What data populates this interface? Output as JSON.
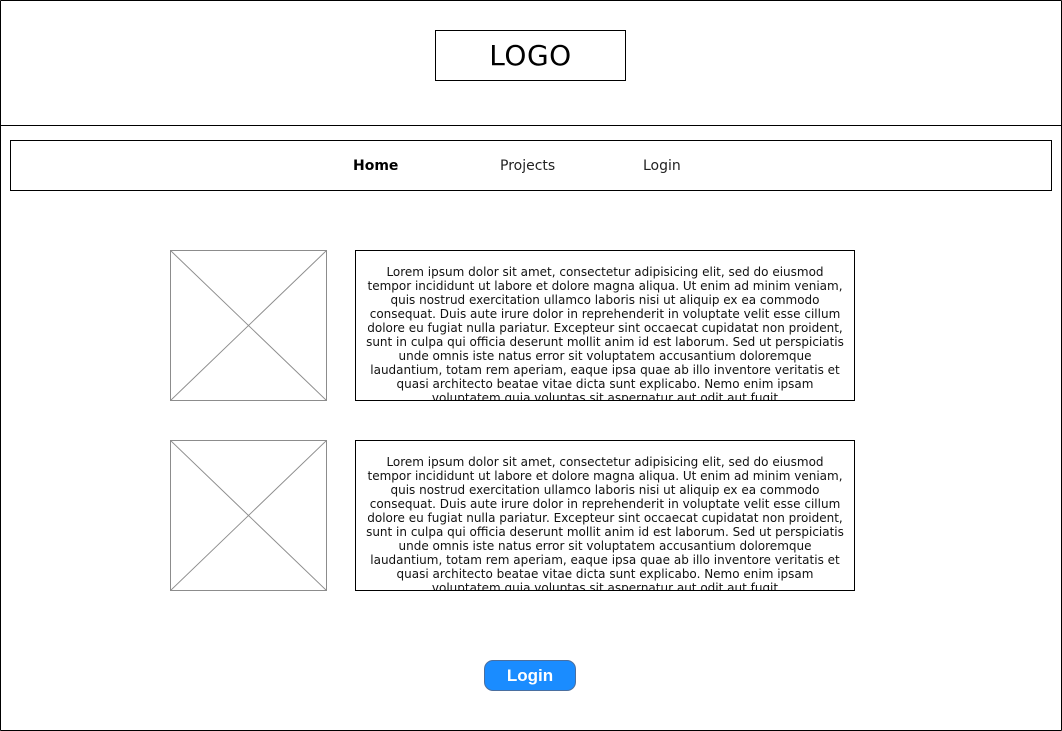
{
  "header": {
    "logo_text": "LOGO"
  },
  "nav": {
    "items": [
      {
        "label": "Home",
        "active": true
      },
      {
        "label": "Projects",
        "active": false
      },
      {
        "label": "Login",
        "active": false
      }
    ]
  },
  "content": {
    "rows": [
      {
        "image_icon": "image-placeholder-icon",
        "text": "Lorem ipsum dolor sit amet, consectetur adipisicing elit, sed do eiusmod tempor incididunt ut labore et dolore magna aliqua. Ut enim ad minim veniam, quis nostrud exercitation ullamco laboris nisi ut aliquip ex ea commodo consequat. Duis aute irure dolor in reprehenderit in voluptate velit esse cillum dolore eu fugiat nulla pariatur. Excepteur sint occaecat cupidatat non proident, sunt in culpa qui officia deserunt mollit anim id est laborum. Sed ut perspiciatis unde omnis iste natus error sit voluptatem accusantium doloremque laudantium, totam rem aperiam, eaque ipsa quae ab illo inventore veritatis et quasi architecto beatae vitae dicta sunt explicabo. Nemo enim ipsam voluptatem quia voluptas sit aspernatur aut odit aut fugit"
      },
      {
        "image_icon": "image-placeholder-icon",
        "text": "Lorem ipsum dolor sit amet, consectetur adipisicing elit, sed do eiusmod tempor incididunt ut labore et dolore magna aliqua. Ut enim ad minim veniam, quis nostrud exercitation ullamco laboris nisi ut aliquip ex ea commodo consequat. Duis aute irure dolor in reprehenderit in voluptate velit esse cillum dolore eu fugiat nulla pariatur. Excepteur sint occaecat cupidatat non proident, sunt in culpa qui officia deserunt mollit anim id est laborum. Sed ut perspiciatis unde omnis iste natus error sit voluptatem accusantium doloremque laudantium, totam rem aperiam, eaque ipsa quae ab illo inventore veritatis et quasi architecto beatae vitae dicta sunt explicabo. Nemo enim ipsam voluptatem quia voluptas sit aspernatur aut odit aut fugit"
      }
    ]
  },
  "footer": {
    "login_button_label": "Login"
  },
  "colors": {
    "accent": "#1a8cff",
    "border": "#000000",
    "placeholder": "#8c8c8c"
  }
}
